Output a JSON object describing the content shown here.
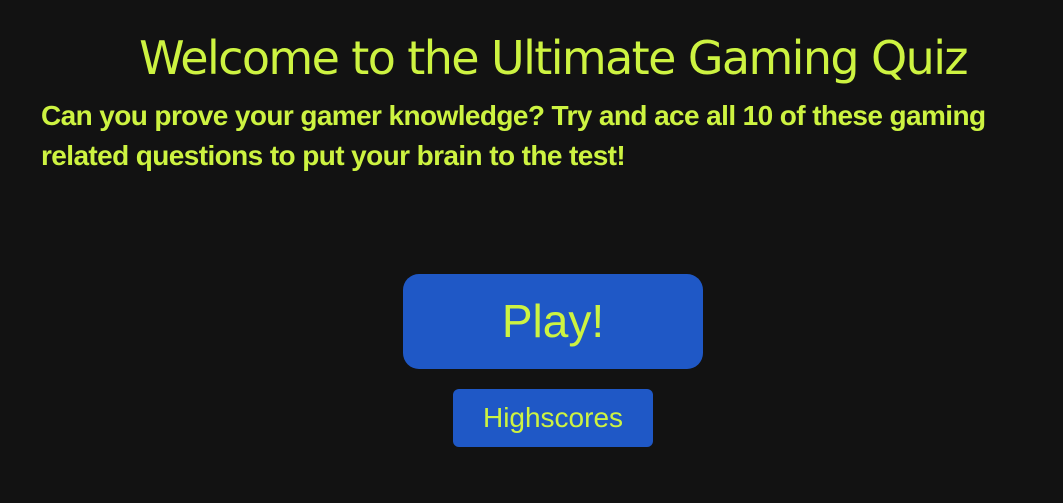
{
  "welcome": {
    "title": "Welcome to the Ultimate Gaming Quiz",
    "subtitle": "Can you prove your gamer knowledge? Try and ace all 10 of these gaming related questions to put your brain to the test!"
  },
  "actions": {
    "play_label": "Play!",
    "highscores_label": "Highscores"
  },
  "colors": {
    "background": "#121212",
    "accent_text": "#cdf341",
    "button": "#1f58c6"
  }
}
